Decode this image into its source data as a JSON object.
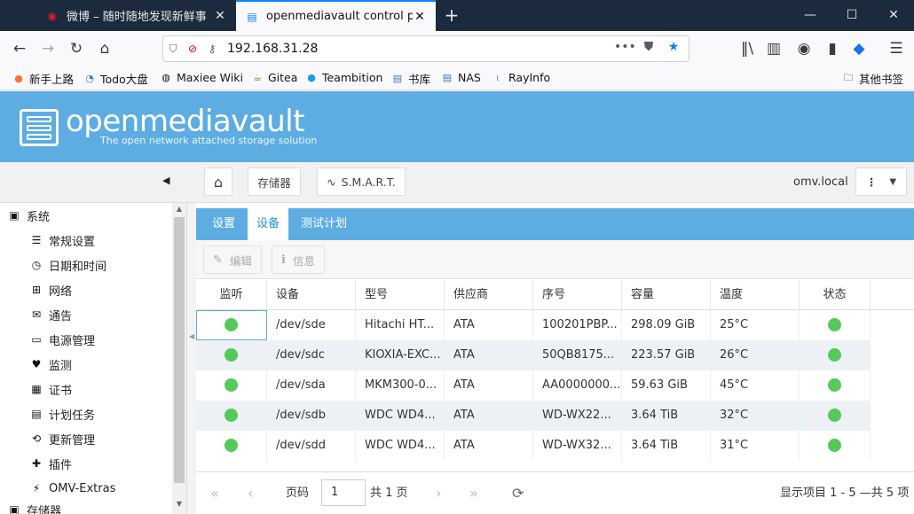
{
  "browser": {
    "tabs": [
      {
        "label": "微博 – 随时随地发现新鲜事",
        "icon": "weibo-icon"
      },
      {
        "label": "openmediavault control panel",
        "icon": "omv-tab-icon"
      }
    ],
    "url": "192.168.31.28"
  },
  "bookmarks": [
    {
      "label": "新手上路",
      "icon": "firefox-icon"
    },
    {
      "label": "Todo大盘",
      "icon": "todo-icon"
    },
    {
      "label": "Maxiee Wiki",
      "icon": "globe-icon"
    },
    {
      "label": "Gitea",
      "icon": "gitea-icon"
    },
    {
      "label": "Teambition",
      "icon": "teambition-icon"
    },
    {
      "label": "书库",
      "icon": "page-icon"
    },
    {
      "label": "NAS",
      "icon": "page-icon"
    },
    {
      "label": "RayInfo",
      "icon": "rayinfo-icon"
    },
    {
      "label": "其他书签",
      "icon": "folder-icon"
    }
  ],
  "omv": {
    "brand": "openmediavault",
    "tagline": "The open network attached storage solution",
    "breadcrumb": [
      "存储器",
      "S.M.A.R.T."
    ],
    "hostname": "omv.local"
  },
  "sidebar": {
    "items": [
      {
        "label": "系统",
        "icon": "minus-square-icon"
      },
      {
        "label": "常规设置",
        "icon": "sliders-icon"
      },
      {
        "label": "日期和时间",
        "icon": "clock-icon"
      },
      {
        "label": "网络",
        "icon": "network-icon"
      },
      {
        "label": "通告",
        "icon": "envelope-icon"
      },
      {
        "label": "电源管理",
        "icon": "battery-icon"
      },
      {
        "label": "监测",
        "icon": "heartbeat-icon"
      },
      {
        "label": "证书",
        "icon": "certificate-icon"
      },
      {
        "label": "计划任务",
        "icon": "calendar-clock-icon"
      },
      {
        "label": "更新管理",
        "icon": "refresh-icon"
      },
      {
        "label": "插件",
        "icon": "puzzle-icon"
      },
      {
        "label": "OMV-Extras",
        "icon": "plug-icon"
      },
      {
        "label": "存储器",
        "icon": "minus-square-icon"
      }
    ]
  },
  "panel": {
    "tabs": [
      "设置",
      "设备",
      "测试计划"
    ],
    "active_tab": "设备",
    "actions": [
      {
        "label": "编辑",
        "icon": "pencil-icon"
      },
      {
        "label": "信息",
        "icon": "info-icon"
      }
    ],
    "columns": [
      "监听",
      "设备",
      "型号",
      "供应商",
      "序号",
      "容量",
      "温度",
      "状态"
    ],
    "rows": [
      {
        "device": "/dev/sde",
        "model": "Hitachi HT...",
        "vendor": "ATA",
        "serial": "100201PBP...",
        "capacity": "298.09 GiB",
        "temp": "25°C"
      },
      {
        "device": "/dev/sdc",
        "model": "KIOXIA-EXC...",
        "vendor": "ATA",
        "serial": "50QB8175...",
        "capacity": "223.57 GiB",
        "temp": "26°C"
      },
      {
        "device": "/dev/sda",
        "model": "MKM300-0...",
        "vendor": "ATA",
        "serial": "AA0000000...",
        "capacity": "59.63 GiB",
        "temp": "45°C"
      },
      {
        "device": "/dev/sdb",
        "model": "WDC WD4...",
        "vendor": "ATA",
        "serial": "WD-WX22...",
        "capacity": "3.64 TiB",
        "temp": "32°C"
      },
      {
        "device": "/dev/sdd",
        "model": "WDC WD4...",
        "vendor": "ATA",
        "serial": "WD-WX32...",
        "capacity": "3.64 TiB",
        "temp": "31°C"
      }
    ],
    "pager": {
      "page_label": "页码",
      "page_value": "1",
      "total_pages": "共 1 页",
      "summary": "显示项目 1 - 5 —共 5 项"
    }
  },
  "colors": {
    "brand_blue": "#5dade2",
    "status_green": "#55c95a"
  }
}
